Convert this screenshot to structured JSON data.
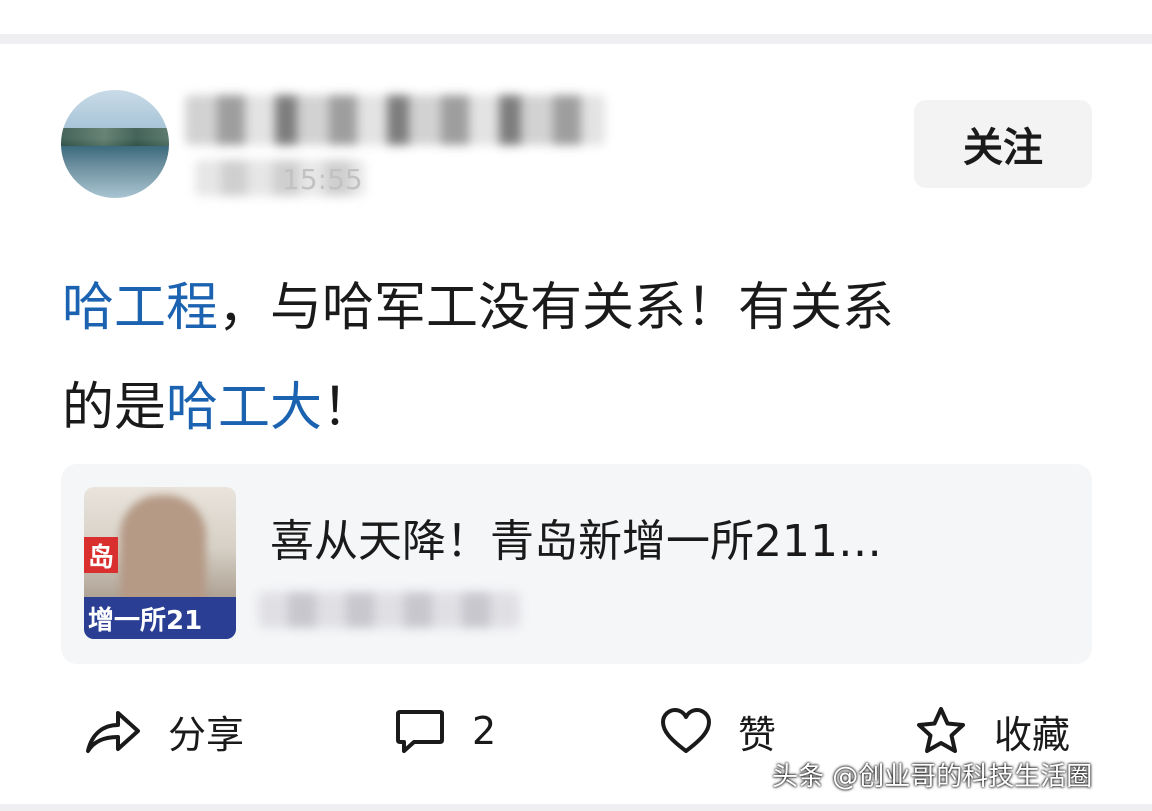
{
  "author": {
    "time_visible": "15:55"
  },
  "follow_button": {
    "label": "关注"
  },
  "post": {
    "line1": [
      {
        "text": "哈工程",
        "link": true
      },
      {
        "text": "，与哈军工没有关系！有关系",
        "link": false
      }
    ],
    "line2": [
      {
        "text": "的是",
        "link": false
      },
      {
        "text": "哈工大",
        "link": true
      },
      {
        "text": "！",
        "link": false
      }
    ]
  },
  "linked_card": {
    "title": "喜从天降！青岛新增一所211…",
    "thumb_tag": "岛",
    "thumb_banner": "增一所21"
  },
  "actions": {
    "share": {
      "label": "分享",
      "icon": "share-icon"
    },
    "comment": {
      "label": "2",
      "icon": "comment-icon"
    },
    "like": {
      "label": "赞",
      "icon": "heart-icon"
    },
    "collect": {
      "label": "收藏",
      "icon": "star-icon"
    }
  },
  "watermark": "头条 @创业哥的科技生活圈",
  "colors": {
    "link": "#1b63b1",
    "card_bg": "#f5f6f8",
    "button_bg": "#f3f3f4"
  }
}
